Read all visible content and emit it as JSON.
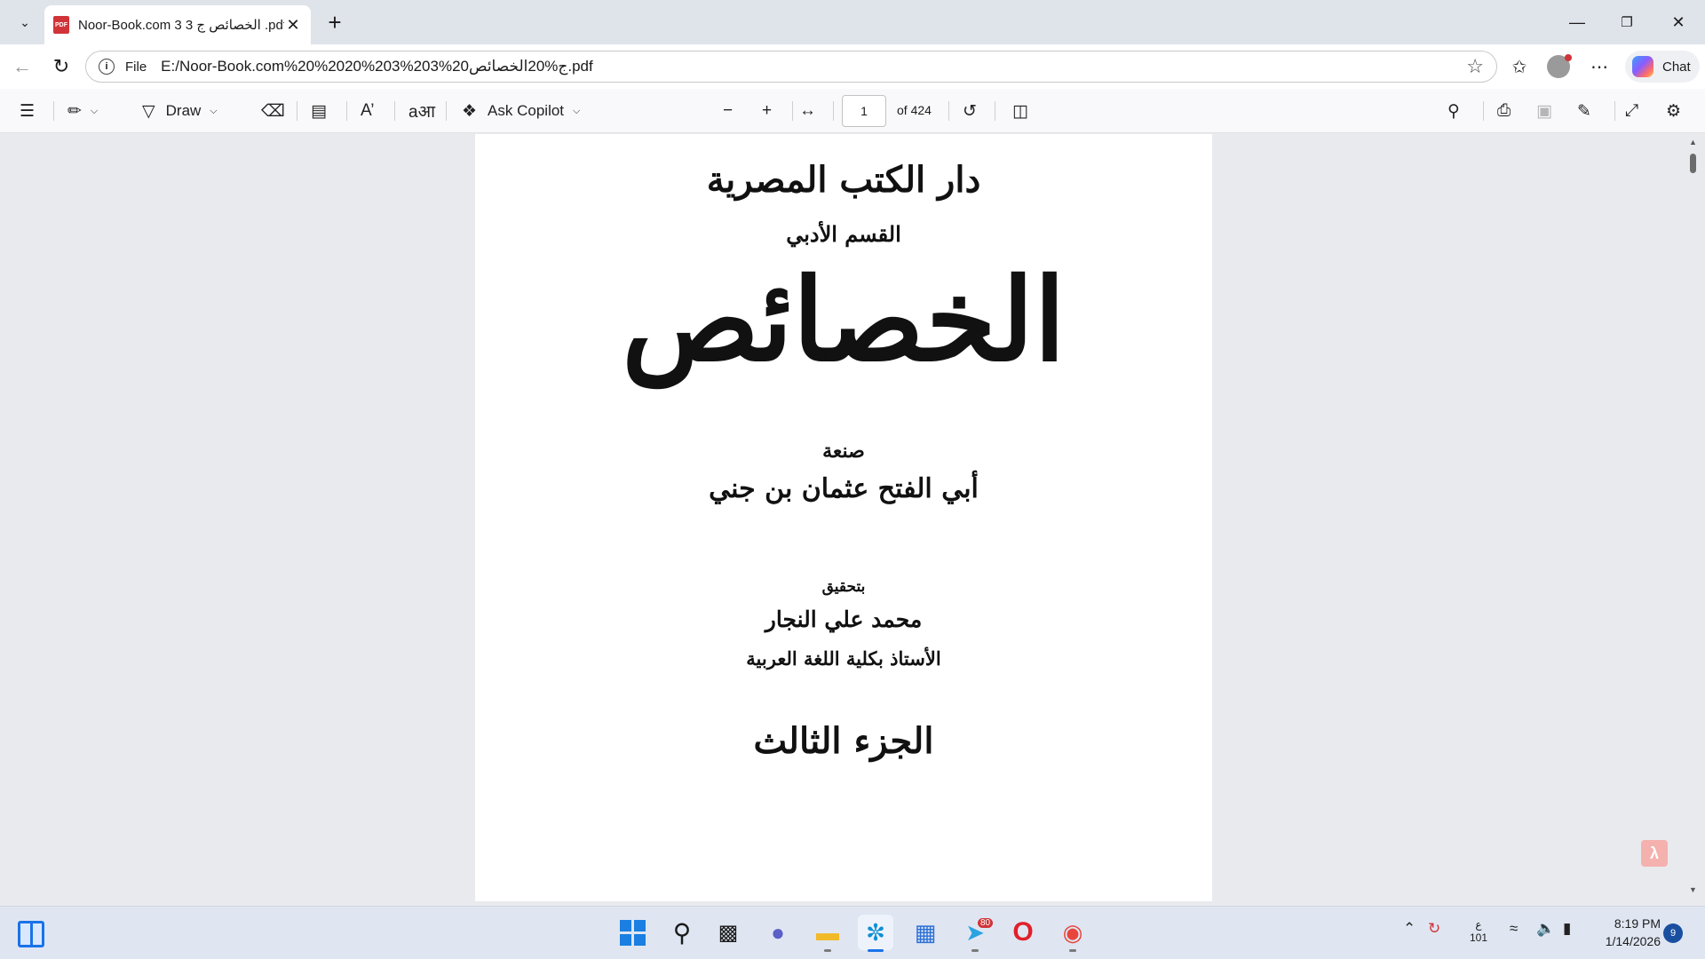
{
  "browser": {
    "tab_title": "Noor-Book.com الخصائص ج 3 3 .pdf",
    "tab_badge": "PDF",
    "url_scheme": "File",
    "url": "E:/Noor-Book.com%20%2020%203%203%20ج%20الخصائص.pdf",
    "chat_label": "Chat",
    "accent_color": "#1a73e8"
  },
  "toolbar": {
    "draw_label": "Draw",
    "ask_copilot_label": "Ask Copilot",
    "current_page": "1",
    "page_total": "of 424"
  },
  "page": {
    "publisher": "دار الكتب المصرية",
    "section": "القسم الأدبي",
    "title": "الخصائص",
    "made_by": "صنعة",
    "author": "أبي الفتح عثمان بن جني",
    "edited_by": "بتحقيق",
    "editor": "محمد علي النجار",
    "editor_title": "الأستاذ بكلية اللغة العربية",
    "volume": "الجزء الثالث"
  },
  "taskbar": {
    "telegram_badge": "80",
    "lang_line1": "ع",
    "lang_line2": "101",
    "time": "8:19 PM",
    "date": "1/14/2026",
    "notifications": "9"
  },
  "icons": [
    "tab-menu-icon",
    "pdf-icon",
    "close-icon",
    "plus-icon",
    "minimize-icon",
    "maximize-icon",
    "back-icon",
    "refresh-icon",
    "info-icon",
    "star-icon",
    "favorites-icon",
    "more-icon",
    "copilot-icon",
    "contents-icon",
    "highlight-icon",
    "draw-icon",
    "eraser-icon",
    "text-box-icon",
    "read-aloud-icon",
    "translate-icon",
    "zoom-out-icon",
    "zoom-in-icon",
    "fit-width-icon",
    "rotate-icon",
    "page-view-icon",
    "search-icon",
    "print-icon",
    "save-icon",
    "save-as-icon",
    "fullscreen-icon",
    "settings-icon",
    "windows-start-icon",
    "search-icon",
    "task-view-icon",
    "teams-icon",
    "file-explorer-icon",
    "edge-icon",
    "store-icon",
    "telegram-icon",
    "opera-icon",
    "chrome-icon",
    "wifi-icon",
    "volume-icon",
    "battery-icon"
  ]
}
